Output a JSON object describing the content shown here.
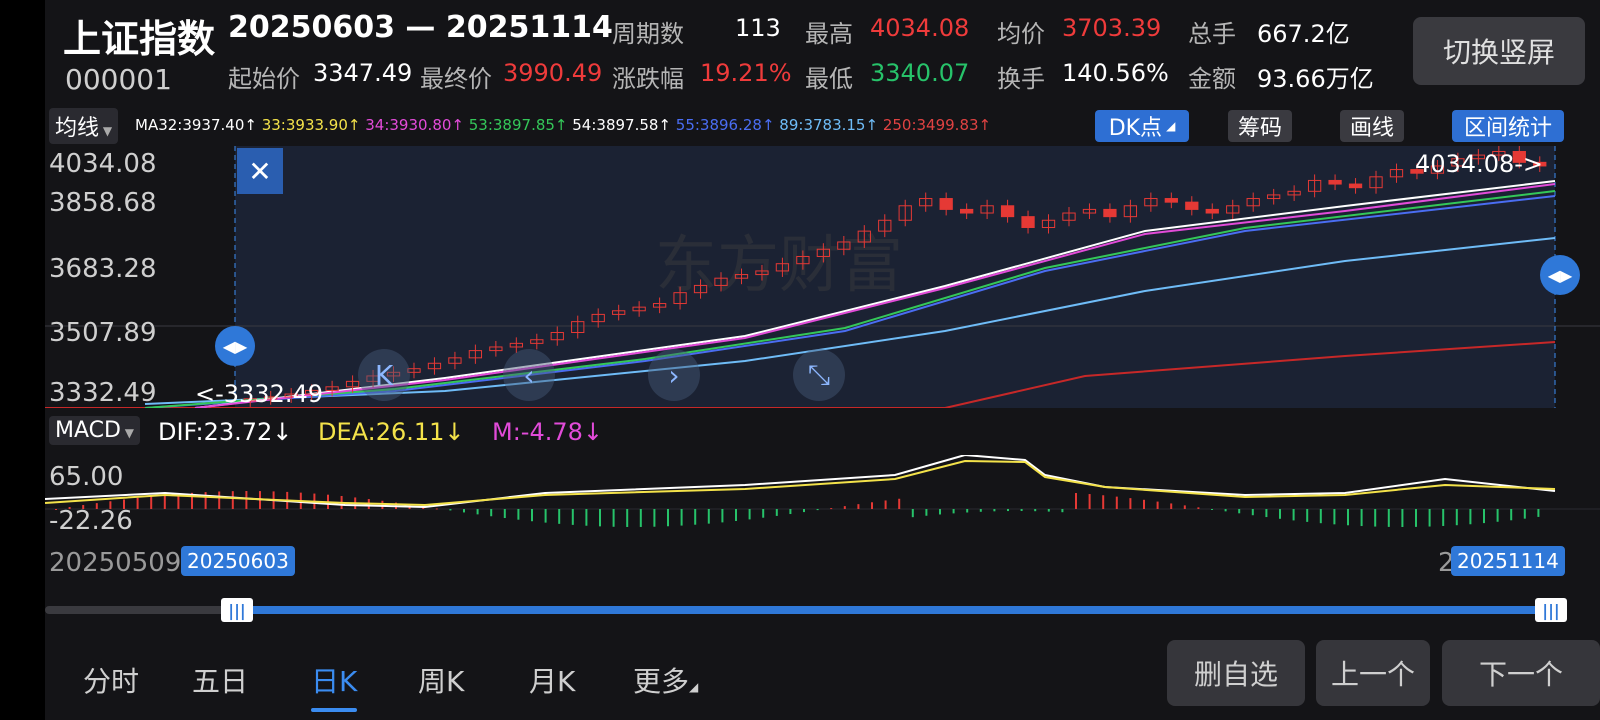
{
  "header": {
    "title": "上证指数",
    "code": "000001",
    "date_range": "20250603 — 20251114",
    "stats": {
      "periods_label": "周期数",
      "periods_value": "113",
      "high_label": "最高",
      "high_value": "4034.08",
      "avg_label": "均价",
      "avg_value": "3703.39",
      "volume_label": "总手",
      "volume_value": "667.2亿",
      "start_label": "起始价",
      "start_value": "3347.49",
      "end_label": "最终价",
      "end_value": "3990.49",
      "change_label": "涨跌幅",
      "change_value": "19.21%",
      "low_label": "最低",
      "low_value": "3340.07",
      "turnover_label": "换手",
      "turnover_value": "140.56%",
      "amount_label": "金额",
      "amount_value": "93.66万亿"
    },
    "switch_button": "切换竖屏"
  },
  "indicator_bar": {
    "selector": "均线",
    "ma_items": [
      {
        "text": "MA32:3937.40↑",
        "color": "#ffffff"
      },
      {
        "text": "33:3933.90↑",
        "color": "#f3e24a"
      },
      {
        "text": "34:3930.80↑",
        "color": "#e24bd9"
      },
      {
        "text": "53:3897.85↑",
        "color": "#34c759"
      },
      {
        "text": "54:3897.58↑",
        "color": "#ffffff"
      },
      {
        "text": "55:3896.28↑",
        "color": "#4a6df2"
      },
      {
        "text": "89:3783.15↑",
        "color": "#6fbcf7"
      },
      {
        "text": "250:3499.83↑",
        "color": "#e04242"
      }
    ],
    "buttons": {
      "dk": "DK点",
      "chips": "筹码",
      "draw": "画线",
      "range_stats": "区间统计"
    }
  },
  "main_chart": {
    "y_ticks": [
      "4034.08",
      "3858.68",
      "3683.28",
      "3507.89",
      "3332.49"
    ],
    "high_marker": "4034.08->",
    "low_marker": "<-3332.49",
    "watermark": "东方财富"
  },
  "macd": {
    "selector": "MACD",
    "dif": "DIF:23.72↓",
    "dea": "DEA:26.11↓",
    "m": "M:-4.78↓",
    "y_ticks": [
      "65.00",
      "-22.26"
    ]
  },
  "range_slider": {
    "left_date": "20250509",
    "start_chip": "20250603",
    "right_partial": "2",
    "end_chip": "20251114",
    "start_fraction": 0.13,
    "end_fraction": 1.0
  },
  "tabs": [
    {
      "label": "分时",
      "active": false
    },
    {
      "label": "五日",
      "active": false
    },
    {
      "label": "日K",
      "active": true
    },
    {
      "label": "周K",
      "active": false
    },
    {
      "label": "月K",
      "active": false
    },
    {
      "label": "更多",
      "active": false
    }
  ],
  "bottom_buttons": {
    "remove": "删自选",
    "prev": "上一个",
    "next": "下一个"
  },
  "chart_data": {
    "type": "candlestick",
    "x_range": [
      "20250603",
      "20251114"
    ],
    "y_range": [
      3332.49,
      4034.08
    ],
    "close_series": [
      3347,
      3352,
      3360,
      3370,
      3380,
      3395,
      3410,
      3420,
      3430,
      3445,
      3460,
      3480,
      3490,
      3500,
      3510,
      3530,
      3560,
      3580,
      3590,
      3600,
      3610,
      3640,
      3660,
      3680,
      3690,
      3700,
      3720,
      3740,
      3760,
      3780,
      3810,
      3840,
      3880,
      3900,
      3870,
      3860,
      3880,
      3850,
      3820,
      3840,
      3860,
      3870,
      3850,
      3880,
      3900,
      3890,
      3870,
      3860,
      3880,
      3900,
      3910,
      3920,
      3950,
      3940,
      3930,
      3960,
      3980,
      3970,
      3990,
      4010,
      4020,
      4030,
      4000,
      3990
    ]
  }
}
